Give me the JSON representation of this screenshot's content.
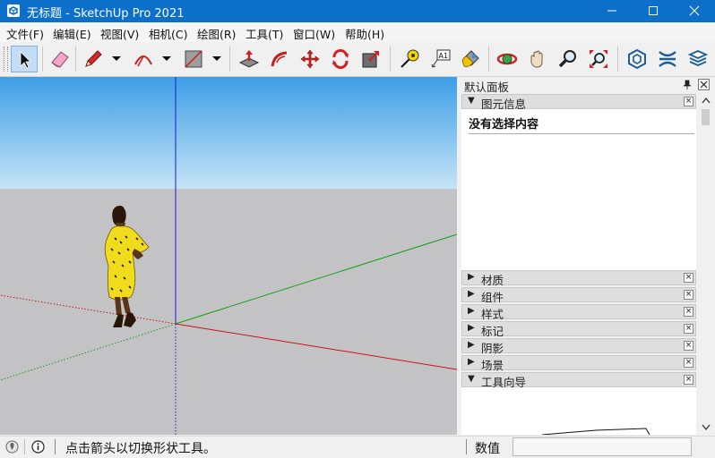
{
  "window": {
    "title": "无标题 - SketchUp Pro 2021",
    "colors": {
      "titlebar": "#0c6fca",
      "sky": "#4aa9e8",
      "ground": "#c3c3c5"
    }
  },
  "menu": {
    "items": [
      "文件(F)",
      "编辑(E)",
      "视图(V)",
      "相机(C)",
      "绘图(R)",
      "工具(T)",
      "窗口(W)",
      "帮助(H)"
    ]
  },
  "toolbar": {
    "tools": [
      {
        "name": "select-tool",
        "icon": "arrow-cursor-icon",
        "active": true
      },
      {
        "name": "eraser-tool",
        "icon": "eraser-icon"
      },
      {
        "name": "line-tool",
        "icon": "pencil-icon"
      },
      {
        "name": "arc-tool",
        "icon": "arc-icon"
      },
      {
        "name": "rectangle-tool",
        "icon": "rectangle-icon"
      },
      {
        "name": "push-pull-tool",
        "icon": "push-pull-icon"
      },
      {
        "name": "follow-me-tool",
        "icon": "follow-me-icon"
      },
      {
        "name": "move-tool",
        "icon": "move-icon"
      },
      {
        "name": "rotate-tool",
        "icon": "rotate-icon"
      },
      {
        "name": "scale-tool",
        "icon": "scale-icon"
      },
      {
        "name": "tape-measure-tool",
        "icon": "tape-measure-icon"
      },
      {
        "name": "text-tool",
        "icon": "text-label-icon"
      },
      {
        "name": "paint-bucket-tool",
        "icon": "paint-bucket-icon"
      },
      {
        "name": "orbit-tool",
        "icon": "orbit-icon"
      },
      {
        "name": "pan-tool",
        "icon": "hand-icon"
      },
      {
        "name": "zoom-tool",
        "icon": "magnifier-icon"
      },
      {
        "name": "zoom-extents-tool",
        "icon": "zoom-extents-icon"
      },
      {
        "name": "warehouse-tool",
        "icon": "warehouse-icon"
      },
      {
        "name": "extension-warehouse-tool",
        "icon": "extension-icon"
      },
      {
        "name": "layers-tool",
        "icon": "layers-icon"
      }
    ],
    "text_tool_glyph": "A1"
  },
  "panel": {
    "title": "默认面板",
    "entity_info": {
      "label": "图元信息",
      "expanded": true,
      "message": "没有选择内容"
    },
    "trays": [
      {
        "label": "材质",
        "expanded": false
      },
      {
        "label": "组件",
        "expanded": false
      },
      {
        "label": "样式",
        "expanded": false
      },
      {
        "label": "标记",
        "expanded": false
      },
      {
        "label": "阴影",
        "expanded": false
      },
      {
        "label": "场景",
        "expanded": false
      },
      {
        "label": "工具向导",
        "expanded": true
      }
    ],
    "close_glyph": "×",
    "collapsed_glyph": "▶",
    "expanded_glyph": "▼"
  },
  "status": {
    "hint": "点击箭头以切换形状工具。",
    "measurements_label": "数值",
    "measurements_value": ""
  }
}
